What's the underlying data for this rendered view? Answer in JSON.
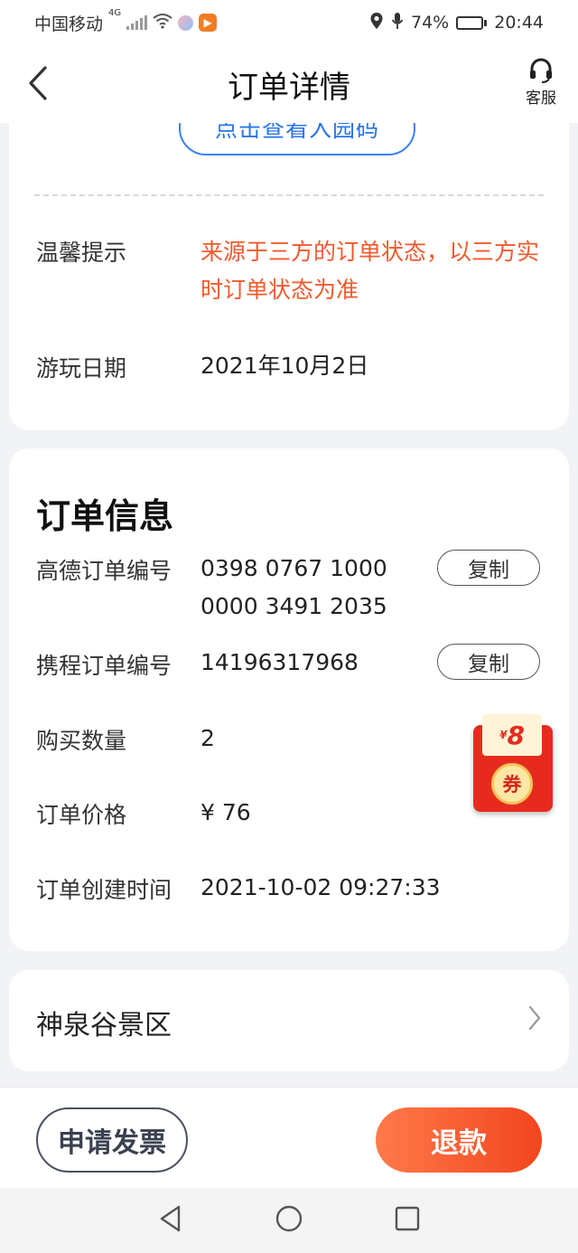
{
  "status_bar": {
    "carrier": "中国移动",
    "network": "4G",
    "battery_percent": "74%",
    "battery_level": 0.74,
    "time": "20:44"
  },
  "nav": {
    "title": "订单详情",
    "service_label": "客服"
  },
  "ticket": {
    "view_code_label": "点击查看入园码",
    "tip_label": "温馨提示",
    "tip_value": "来源于三方的订单状态，以三方实时订单状态为准",
    "play_date_label": "游玩日期",
    "play_date_value": "2021年10月2日"
  },
  "order_info": {
    "title": "订单信息",
    "amap_order_label": "高德订单编号",
    "amap_order_line1": "0398 0767 1000",
    "amap_order_line2": "0000 3491 2035",
    "ctrip_order_label": "携程订单编号",
    "ctrip_order_value": "14196317968",
    "copy_label": "复制",
    "quantity_label": "购买数量",
    "quantity_value": "2",
    "price_label": "订单价格",
    "price_value": "¥ 76",
    "created_label": "订单创建时间",
    "created_value": "2021-10-02 09:27:33"
  },
  "scenic": {
    "name": "神泉谷景区"
  },
  "coupon": {
    "currency": "¥",
    "amount": "8",
    "label": "券"
  },
  "actions": {
    "invoice_label": "申请发票",
    "refund_label": "退款"
  },
  "colors": {
    "accent_blue": "#2a74e8",
    "warning_orange": "#f05a2e",
    "refund_gradient_start": "#ff7a4a",
    "refund_gradient_end": "#f2451e"
  }
}
